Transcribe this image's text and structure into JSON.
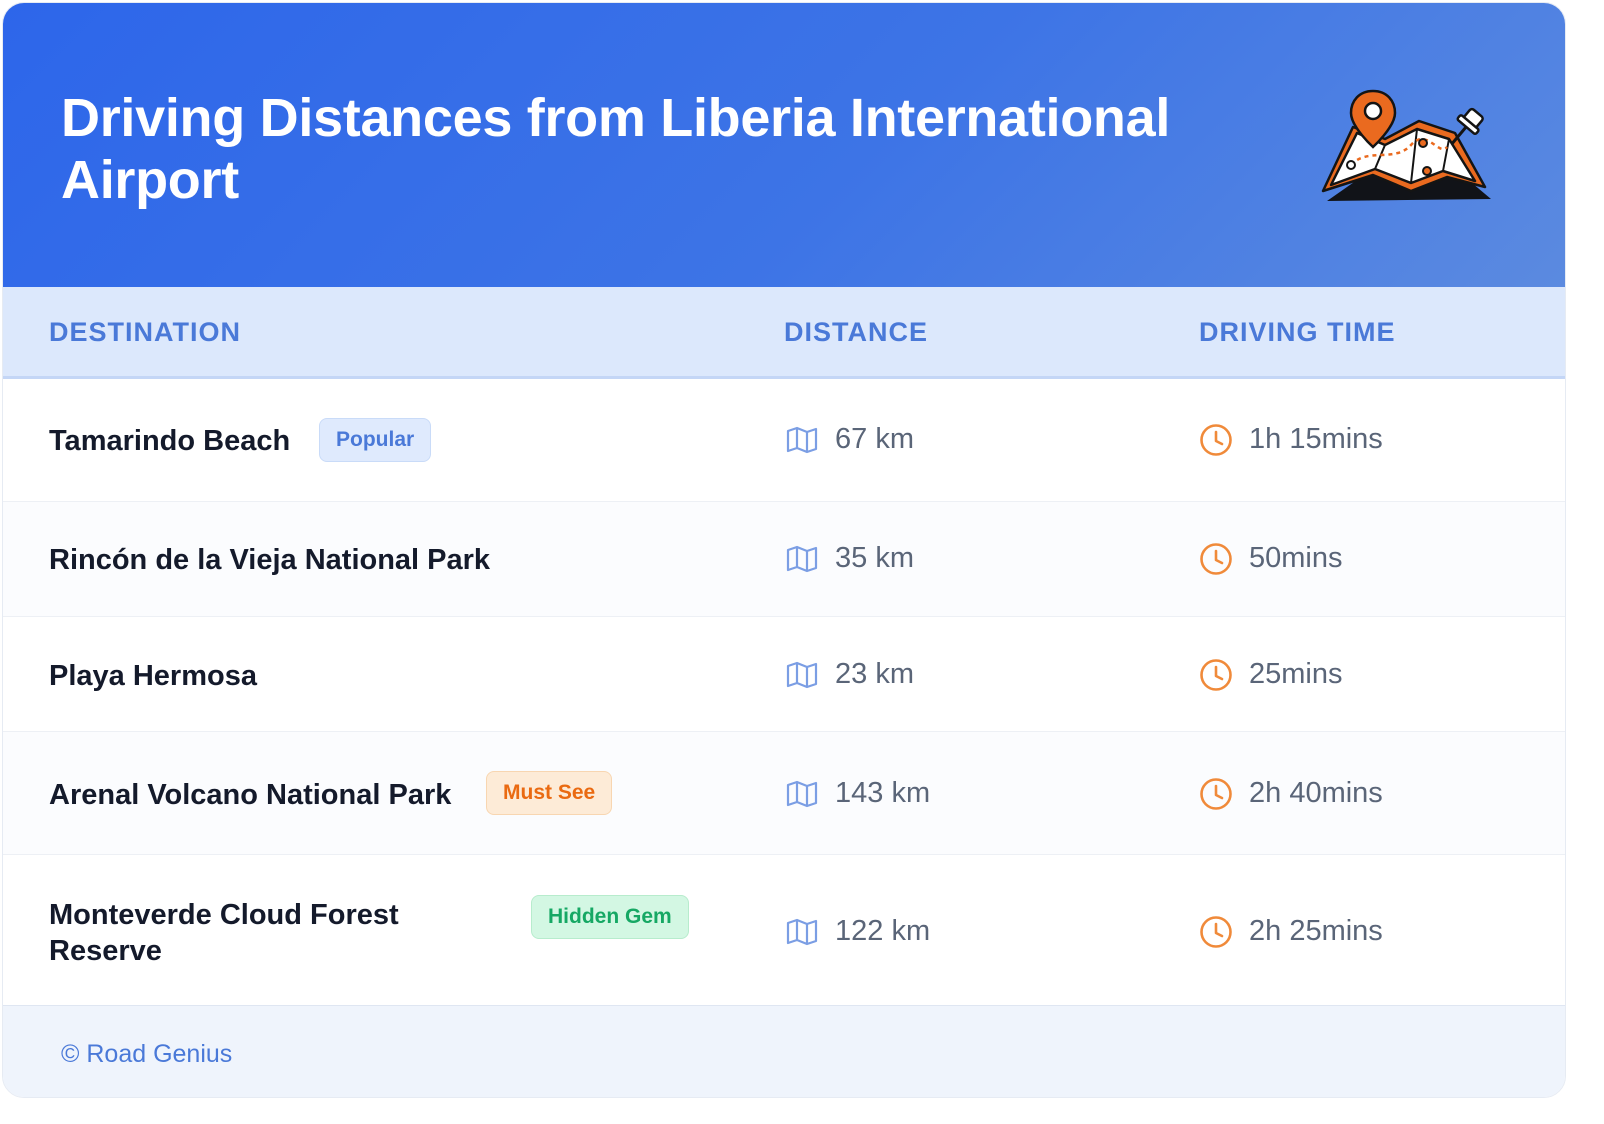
{
  "header": {
    "title": "Driving Distances from Liberia International Airport",
    "illustration_icon": "map-with-pins-icon"
  },
  "table": {
    "columns": [
      "DESTINATION",
      "DISTANCE",
      "DRIVING TIME"
    ],
    "distance_icon": "map-icon",
    "time_icon": "clock-icon",
    "rows": [
      {
        "destination": "Tamarindo Beach",
        "badge": "Popular",
        "distance": "67 km",
        "time": "1h 15mins"
      },
      {
        "destination": "Rincón de la Vieja National Park",
        "badge": "",
        "distance": "35 km",
        "time": "50mins"
      },
      {
        "destination": "Playa Hermosa",
        "badge": "",
        "distance": "23 km",
        "time": "25mins"
      },
      {
        "destination": "Arenal Volcano National Park",
        "badge": "Must See",
        "distance": "143 km",
        "time": "2h 40mins"
      },
      {
        "destination": "Monteverde Cloud Forest Reserve",
        "badge": "Hidden Gem",
        "distance": "122 km",
        "time": "2h 25mins"
      }
    ]
  },
  "footer": {
    "credit": "© Road Genius"
  },
  "colors": {
    "header_start": "#2d66ea",
    "header_end": "#5b8ae0",
    "accent_blue": "#4a79d8",
    "accent_orange": "#ea6a11",
    "accent_green": "#16a864",
    "clock_orange": "#f08a3a"
  }
}
